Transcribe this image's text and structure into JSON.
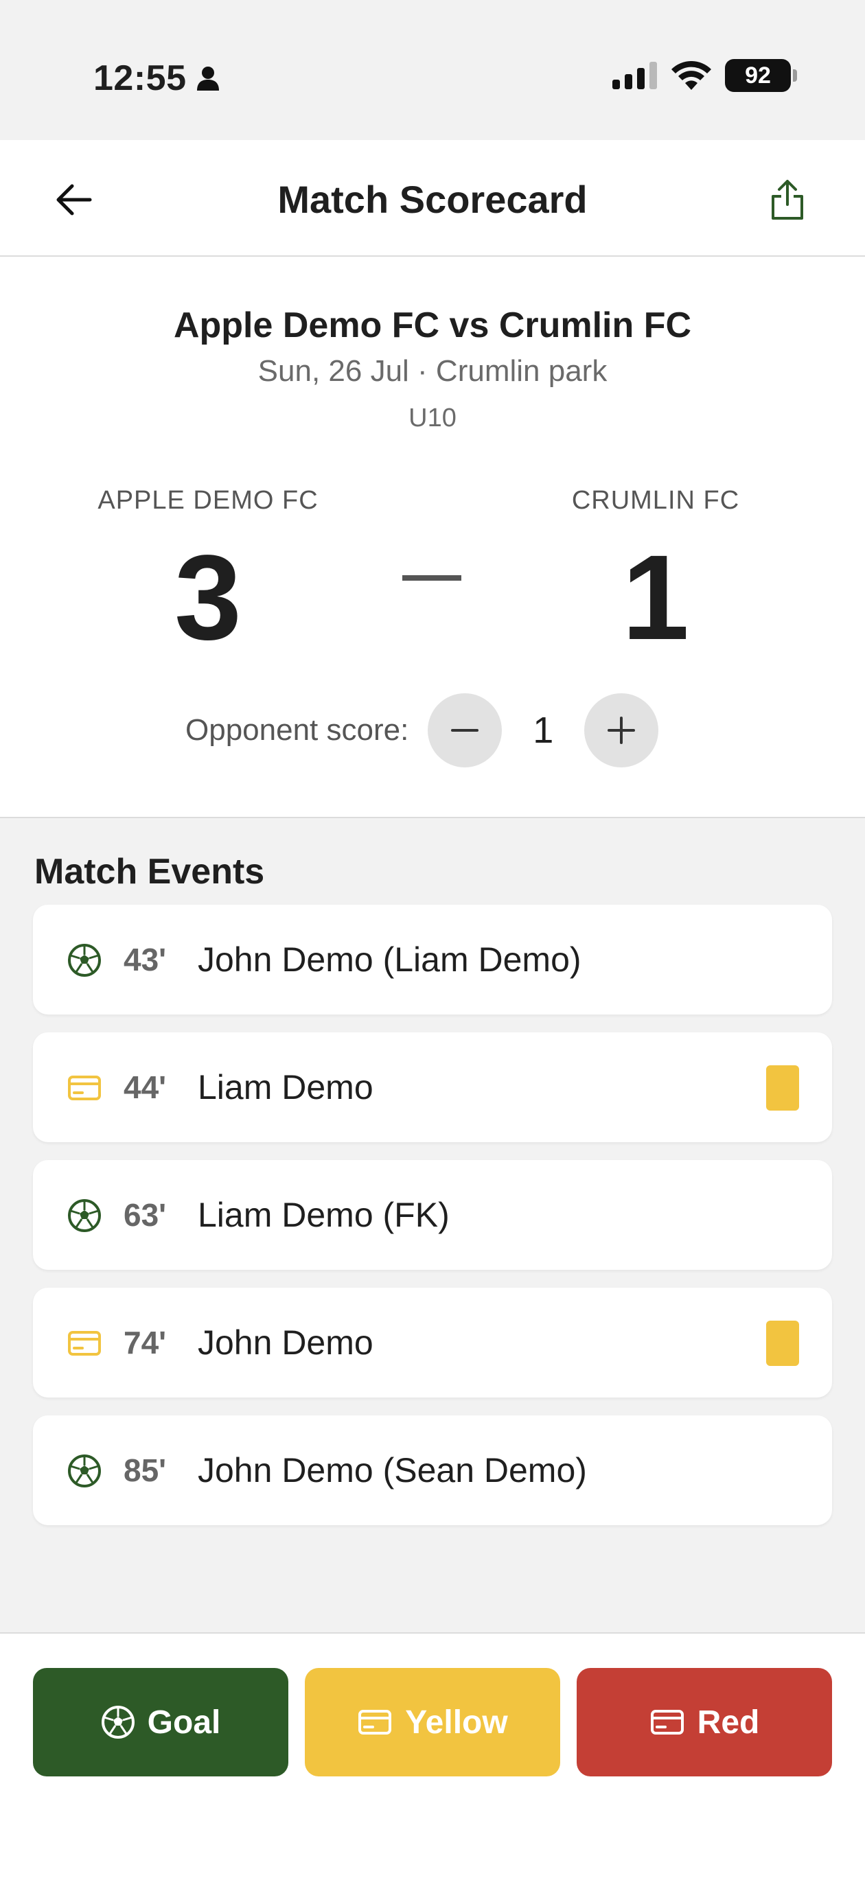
{
  "status": {
    "time": "12:55",
    "battery": "92"
  },
  "nav": {
    "title": "Match Scorecard"
  },
  "match": {
    "title": "Apple Demo FC vs Crumlin FC",
    "subtitle": "Sun, 26 Jul · Crumlin park",
    "age_group": "U10",
    "home": {
      "name": "APPLE DEMO FC",
      "score": "3"
    },
    "away": {
      "name": "CRUMLIN FC",
      "score": "1"
    },
    "opponent_label": "Opponent score:",
    "opponent_value": "1"
  },
  "events": {
    "title": "Match Events",
    "items": [
      {
        "type": "goal",
        "minute": "43'",
        "text": "John Demo (Liam Demo)"
      },
      {
        "type": "yellow",
        "minute": "44'",
        "text": "Liam Demo"
      },
      {
        "type": "goal",
        "minute": "63'",
        "text": "Liam Demo (FK)"
      },
      {
        "type": "yellow",
        "minute": "74'",
        "text": "John Demo"
      },
      {
        "type": "goal",
        "minute": "85'",
        "text": "John Demo (Sean Demo)"
      }
    ]
  },
  "actions": {
    "goal": "Goal",
    "yellow": "Yellow",
    "red": "Red"
  },
  "colors": {
    "goal": "#2d5a27",
    "yellow": "#f2c440",
    "red": "#c43f35"
  }
}
